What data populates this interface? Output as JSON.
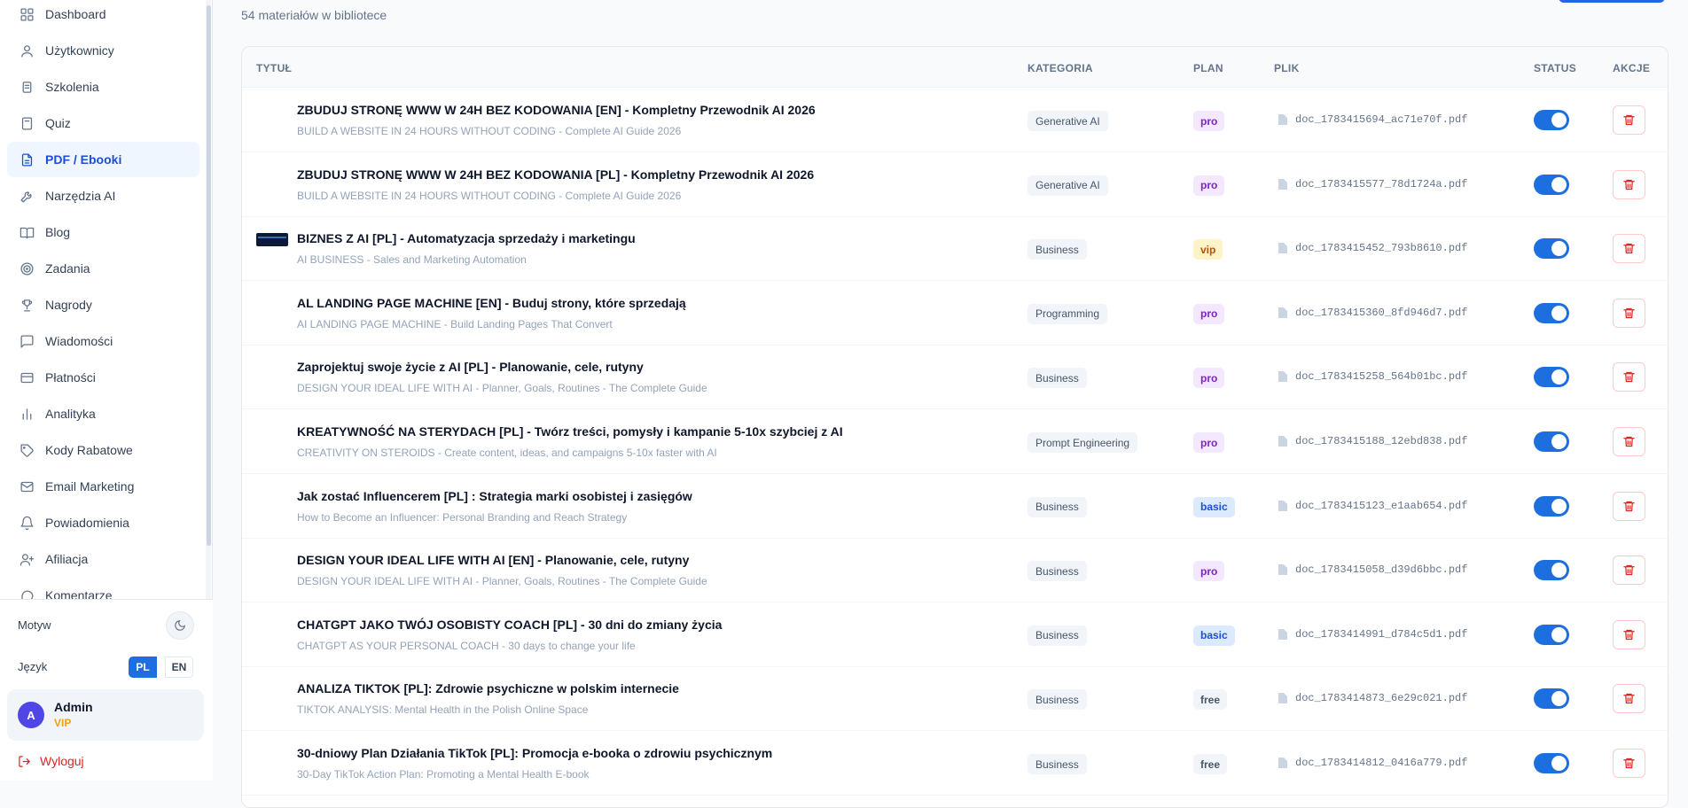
{
  "sidebar": {
    "items": [
      {
        "label": "Dashboard",
        "icon": "grid-icon"
      },
      {
        "label": "Użytkownicy",
        "icon": "users-icon"
      },
      {
        "label": "Szkolenia",
        "icon": "graduation-cap-icon"
      },
      {
        "label": "Quiz",
        "icon": "book-icon"
      },
      {
        "label": "PDF / Ebooki",
        "icon": "file-text-icon",
        "active": true
      },
      {
        "label": "Narzędzia AI",
        "icon": "wrench-icon"
      },
      {
        "label": "Blog",
        "icon": "open-book-icon"
      },
      {
        "label": "Zadania",
        "icon": "target-icon"
      },
      {
        "label": "Nagrody",
        "icon": "trophy-icon"
      },
      {
        "label": "Wiadomości",
        "icon": "message-icon"
      },
      {
        "label": "Płatności",
        "icon": "credit-card-icon"
      },
      {
        "label": "Analityka",
        "icon": "bar-chart-icon"
      },
      {
        "label": "Kody Rabatowe",
        "icon": "tag-icon"
      },
      {
        "label": "Email Marketing",
        "icon": "mail-icon"
      },
      {
        "label": "Powiadomienia",
        "icon": "bell-icon"
      },
      {
        "label": "Afiliacja",
        "icon": "user-plus-icon"
      },
      {
        "label": "Komentarze",
        "icon": "comment-icon"
      }
    ],
    "theme_label": "Motyw",
    "language_label": "Język",
    "lang_pl": "PL",
    "lang_en": "EN",
    "user": {
      "initial": "A",
      "name": "Admin",
      "role": "VIP"
    },
    "logout_label": "Wyloguj"
  },
  "main": {
    "count_text": "54 materiałów w bibliotece",
    "columns": {
      "title": "TYTUŁ",
      "category": "KATEGORIA",
      "plan": "PLAN",
      "file": "PLIK",
      "status": "STATUS",
      "actions": "AKCJE"
    },
    "rows": [
      {
        "title": "ZBUDUJ STRONĘ WWW W 24H BEZ KODOWANIA [EN] - Kompletny Przewodnik AI 2026",
        "subtitle": "BUILD A WEBSITE IN 24 HOURS WITHOUT CODING - Complete AI Guide 2026",
        "category": "Generative AI",
        "plan": "pro",
        "file": "doc_1783415694_ac71e70f.pdf",
        "active": true,
        "thumb": false
      },
      {
        "title": "ZBUDUJ STRONĘ WWW W 24H BEZ KODOWANIA [PL] - Kompletny Przewodnik AI 2026",
        "subtitle": "BUILD A WEBSITE IN 24 HOURS WITHOUT CODING - Complete AI Guide 2026",
        "category": "Generative AI",
        "plan": "pro",
        "file": "doc_1783415577_78d1724a.pdf",
        "active": true,
        "thumb": false
      },
      {
        "title": "BIZNES Z AI [PL] - Automatyzacja sprzedaży i marketingu",
        "subtitle": "AI BUSINESS - Sales and Marketing Automation",
        "category": "Business",
        "plan": "vip",
        "file": "doc_1783415452_793b8610.pdf",
        "active": true,
        "thumb": true
      },
      {
        "title": "AL LANDING PAGE MACHINE [EN] - Buduj strony, które sprzedają",
        "subtitle": "AI LANDING PAGE MACHINE - Build Landing Pages That Convert",
        "category": "Programming",
        "plan": "pro",
        "file": "doc_1783415360_8fd946d7.pdf",
        "active": true,
        "thumb": false
      },
      {
        "title": "Zaprojektuj swoje życie z AI [PL] - Planowanie, cele, rutyny",
        "subtitle": "DESIGN YOUR IDEAL LIFE WITH AI - Planner, Goals, Routines - The Complete Guide",
        "category": "Business",
        "plan": "pro",
        "file": "doc_1783415258_564b01bc.pdf",
        "active": true,
        "thumb": false
      },
      {
        "title": "KREATYWNOŚĆ NA STERYDACH [PL] - Twórz treści, pomysły i kampanie 5-10x szybciej z AI",
        "subtitle": "CREATIVITY ON STEROIDS - Create content, ideas, and campaigns 5-10x faster with AI",
        "category": "Prompt Engineering",
        "plan": "pro",
        "file": "doc_1783415188_12ebd838.pdf",
        "active": true,
        "thumb": false
      },
      {
        "title": "Jak zostać Influencerem [PL] : Strategia marki osobistej i zasięgów",
        "subtitle": "How to Become an Influencer: Personal Branding and Reach Strategy",
        "category": "Business",
        "plan": "basic",
        "file": "doc_1783415123_e1aab654.pdf",
        "active": true,
        "thumb": false
      },
      {
        "title": "DESIGN YOUR IDEAL LIFE WITH AI [EN] - Planowanie, cele, rutyny",
        "subtitle": "DESIGN YOUR IDEAL LIFE WITH AI - Planner, Goals, Routines - The Complete Guide",
        "category": "Business",
        "plan": "pro",
        "file": "doc_1783415058_d39d6bbc.pdf",
        "active": true,
        "thumb": false
      },
      {
        "title": "CHATGPT JAKO TWÓJ OSOBISTY COACH [PL] - 30 dni do zmiany życia",
        "subtitle": "CHATGPT AS YOUR PERSONAL COACH - 30 days to change your life",
        "category": "Business",
        "plan": "basic",
        "file": "doc_1783414991_d784c5d1.pdf",
        "active": true,
        "thumb": false
      },
      {
        "title": "ANALIZA TIKTOK [PL]: Zdrowie psychiczne w polskim internecie",
        "subtitle": "TIKTOK ANALYSIS: Mental Health in the Polish Online Space",
        "category": "Business",
        "plan": "free",
        "file": "doc_1783414873_6e29c021.pdf",
        "active": true,
        "thumb": false
      },
      {
        "title": "30-dniowy Plan Działania TikTok [PL]: Promocja e-booka o zdrowiu psychicznym",
        "subtitle": "30-Day TikTok Action Plan: Promoting a Mental Health E-book",
        "category": "Business",
        "plan": "free",
        "file": "doc_1783414812_0416a779.pdf",
        "active": true,
        "thumb": false
      }
    ]
  },
  "colors": {
    "accent": "#1d6fe0",
    "danger": "#dc2626",
    "vip": "#f59e0b"
  }
}
